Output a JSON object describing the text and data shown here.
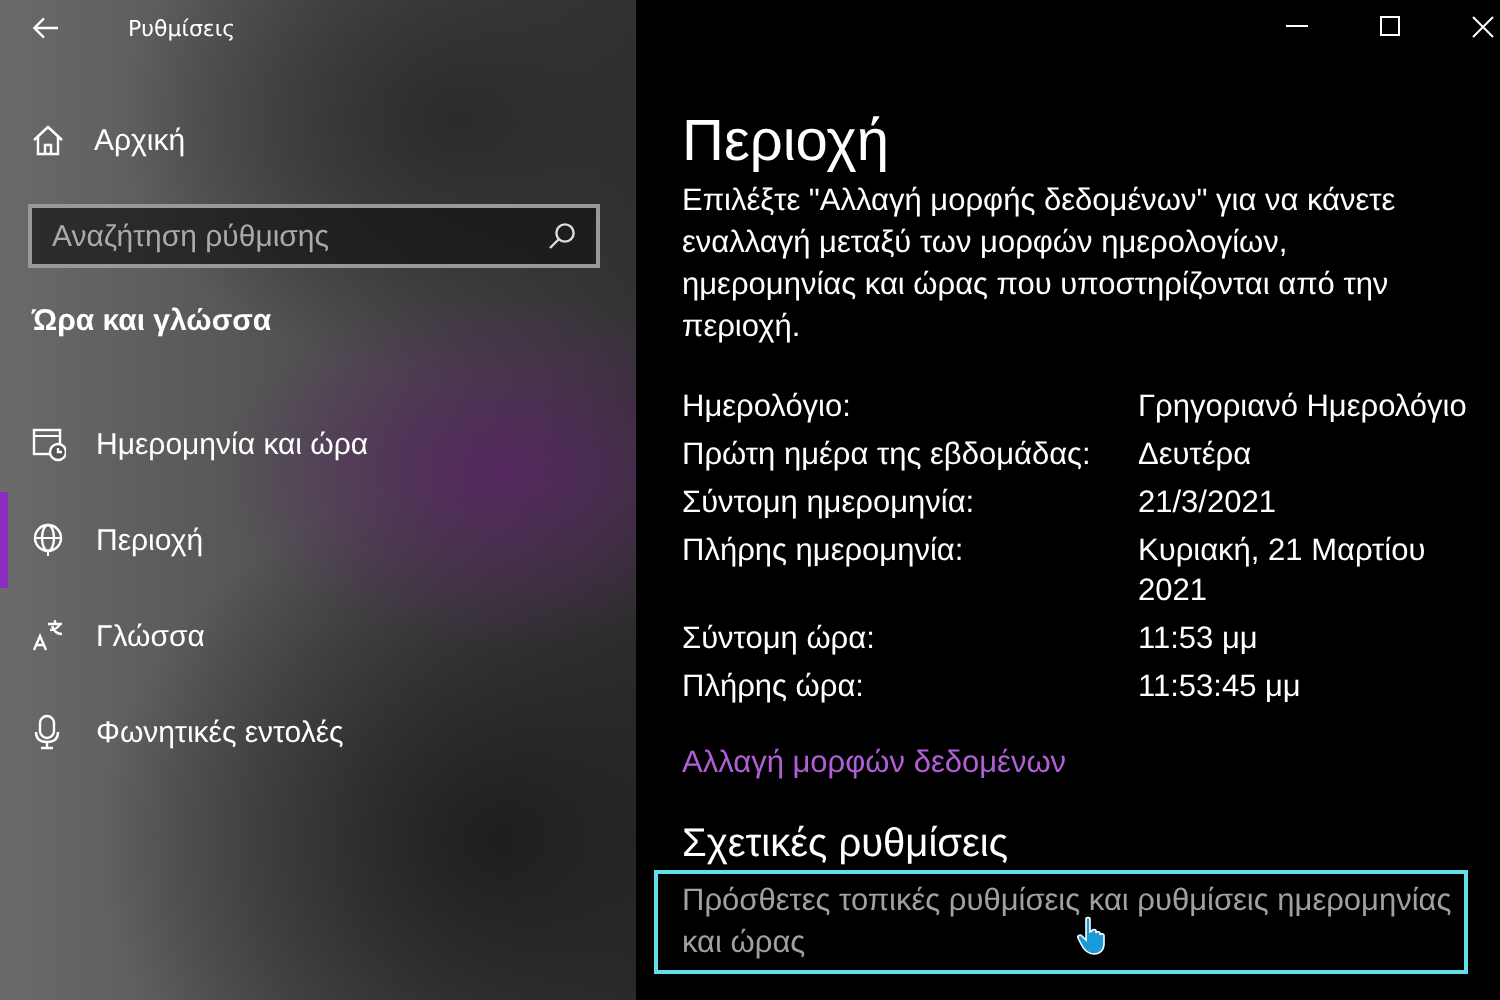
{
  "window": {
    "title": "Ρυθμίσεις"
  },
  "sidebar": {
    "home": "Αρχική",
    "search": {
      "placeholder": "Αναζήτηση ρύθμισης"
    },
    "section_title": "Ώρα και γλώσσα",
    "items": [
      {
        "label": "Ημερομηνία και ώρα",
        "kind": "calendar",
        "selected": false
      },
      {
        "label": "Περιοχή",
        "kind": "globe",
        "selected": true
      },
      {
        "label": "Γλώσσα",
        "kind": "language",
        "selected": false
      },
      {
        "label": "Φωνητικές εντολές",
        "kind": "microphone",
        "selected": false
      }
    ]
  },
  "main": {
    "title": "Περιοχή",
    "description": "Επιλέξτε \"Αλλαγή μορφής δεδομένων\" για να κάνετε εναλλαγή μεταξύ των μορφών ημερολογίων, ημερομηνίας και ώρας που υποστηρίζονται από την περιοχή.",
    "details": [
      {
        "label": "Ημερολόγιο:",
        "value": "Γρηγοριανό Ημερολόγιο"
      },
      {
        "label": "Πρώτη ημέρα της εβδομάδας:",
        "value": "Δευτέρα"
      },
      {
        "label": "Σύντομη ημερομηνία:",
        "value": "21/3/2021"
      },
      {
        "label": "Πλήρης ημερομηνία:",
        "value": "Κυριακή, 21 Μαρτίου 2021"
      },
      {
        "label": "Σύντομη ώρα:",
        "value": "11:53 μμ"
      },
      {
        "label": "Πλήρης ώρα:",
        "value": "11:53:45 μμ"
      }
    ],
    "link": "Αλλαγή μορφών δεδομένων",
    "related": {
      "title": "Σχετικές ρυθμίσεις",
      "link": "Πρόσθετες τοπικές ρυθμίσεις και ρυθμίσεις ημερομηνίας και ώρας",
      "focused": true
    }
  }
}
